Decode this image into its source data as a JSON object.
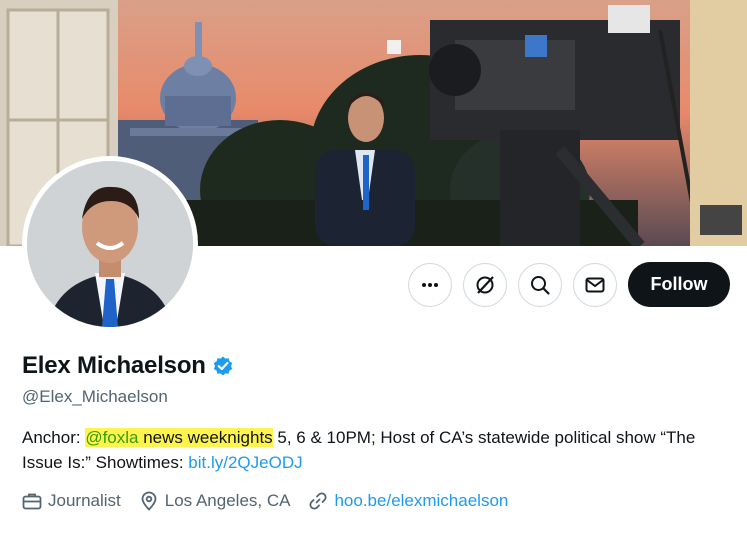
{
  "profile": {
    "display_name": "Elex Michaelson",
    "handle": "@Elex_Michaelson",
    "verified": true,
    "bio": {
      "prefix": "Anchor: ",
      "mention": "@foxla",
      "highlight_rest": " news weeknights",
      "line_rest": " 5, 6 & 10PM; Host of CA’s statewide political show “The Issue Is:” Showtimes: ",
      "link": "bit.ly/2QJeODJ"
    },
    "meta": {
      "profession": "Journalist",
      "location": "Los Angeles, CA",
      "website": "hoo.be/elexmichaelson"
    }
  },
  "actions": {
    "more_icon": "more-icon",
    "grok_icon": "grok-icon",
    "search_icon": "search-icon",
    "message_icon": "mail-icon",
    "follow_label": "Follow"
  },
  "colors": {
    "follow_bg": "#0f1419",
    "link": "#1d9bf0",
    "verified": "#1d9bf0",
    "highlight": "#fff34d",
    "mention": "#36a00e",
    "muted": "#536471"
  }
}
